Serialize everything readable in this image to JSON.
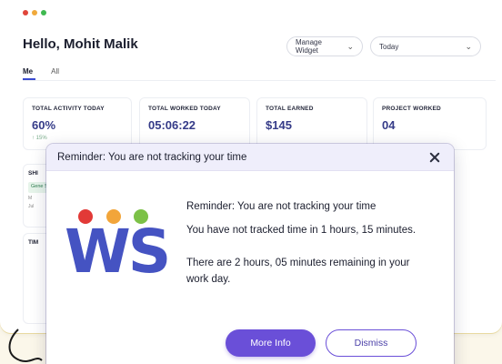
{
  "window": {
    "traffic_lights": [
      "#e0453a",
      "#f0a93b",
      "#3fb950"
    ]
  },
  "header": {
    "greeting": "Hello, Mohit Malik",
    "widget_select": "Manage Widget",
    "date_select": "Today"
  },
  "tabs": [
    {
      "label": "Me",
      "active": true
    },
    {
      "label": "All",
      "active": false
    }
  ],
  "stats": [
    {
      "label": "TOTAL ACTIVITY TODAY",
      "value": "60%",
      "trend": "↑ 15%"
    },
    {
      "label": "TOTAL WORKED TODAY",
      "value": "05:06:22",
      "trend": ""
    },
    {
      "label": "TOTAL EARNED",
      "value": "$145",
      "trend": ""
    },
    {
      "label": "PROJECT WORKED",
      "value": "04",
      "trend": ""
    }
  ],
  "shift_panel": {
    "title": "SHI",
    "chip": "Gene Shi",
    "line1": "M",
    "line2": "Jul"
  },
  "timeline_panel": {
    "title": "TIM"
  },
  "modal": {
    "title": "Reminder: You are not tracking your time",
    "logo_text": "WS",
    "logo_colors": [
      "#e23a37",
      "#f2a53a",
      "#7cc147",
      "#4553c2"
    ],
    "heading": "Reminder: You are not tracking your time",
    "body_1": "You have not tracked time in 1 hours, 15 minutes.",
    "body_2": "There are 2 hours, 05 minutes remaining in your work day.",
    "primary_button": "More Info",
    "secondary_button": "Dismiss"
  }
}
